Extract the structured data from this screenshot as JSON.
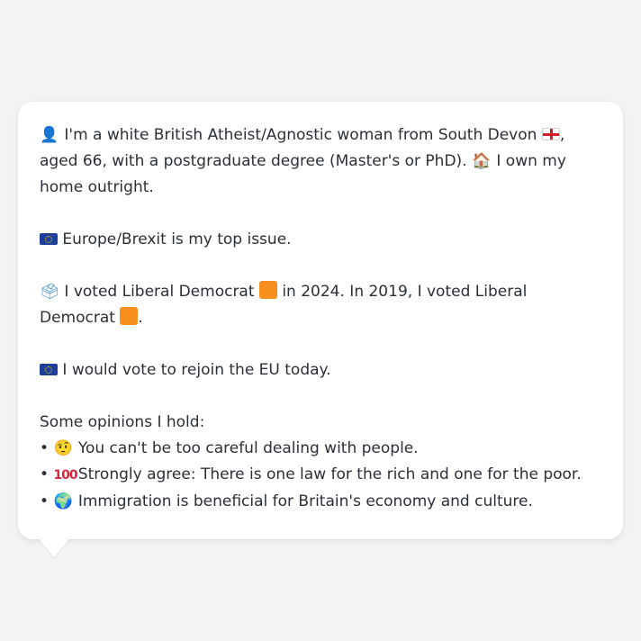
{
  "profile": {
    "line1_part1": "I'm a white British Atheist/Agnostic woman from South Devon",
    "line1_part2": ", aged 66, with a postgraduate degree (Master's or PhD).",
    "line1_part3": "I own my home outright.",
    "top_issue": "Europe/Brexit is my top issue.",
    "vote_part1": "I voted Liberal Democrat",
    "vote_part2": "in 2024. In 2019, I voted Liberal Democrat",
    "vote_part3": ".",
    "eu_vote": "I would vote to rejoin the EU today.",
    "opinions_heading": "Some opinions I hold:",
    "opinions": [
      "You can't be too careful dealing with people.",
      "Strongly agree: There is one law for the rich and one for the poor.",
      "Immigration is beneficial for Britain's economy and culture."
    ],
    "bullet": "•"
  },
  "icons": {
    "person": "person-silhouette-icon",
    "england_flag": "england-flag-icon",
    "house": "house-icon",
    "eu_flag": "eu-flag-icon",
    "ballot": "ballot-box-icon",
    "lib_dem_square": "orange-square-icon",
    "raised_eyebrow": "raised-eyebrow-face-icon",
    "hundred": "hundred-points-icon",
    "globe": "globe-icon"
  },
  "colors": {
    "background": "#f2f3f5",
    "bubble": "#ffffff",
    "text": "#2b2f36",
    "lib_dem_orange": "#f7901e"
  }
}
